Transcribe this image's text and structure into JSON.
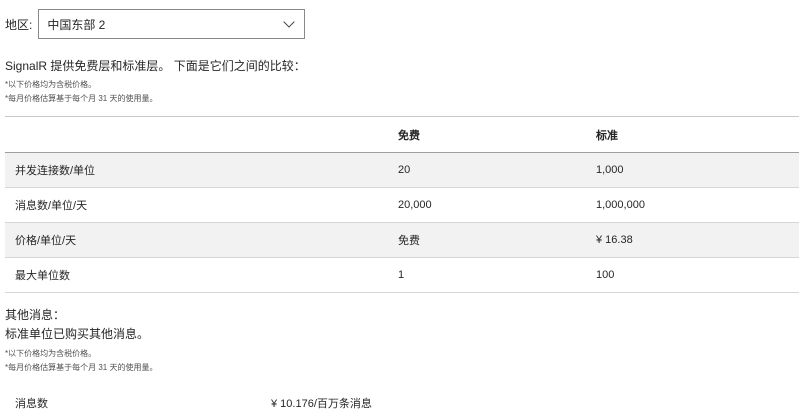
{
  "region": {
    "label": "地区:",
    "selected": "中国东部 2"
  },
  "intro_text": "SignalR 提供免费层和标准层。 下面是它们之间的比较：",
  "notes_top": [
    "*以下价格均为含税价格。",
    "*每月价格估算基于每个月 31 天的使用量。"
  ],
  "table": {
    "headers": [
      "",
      "免费",
      "标准"
    ],
    "rows": [
      [
        "并发连接数/单位",
        "20",
        "1,000"
      ],
      [
        "消息数/单位/天",
        "20,000",
        "1,000,000"
      ],
      [
        "价格/单位/天",
        "免费",
        "¥ 16.38"
      ],
      [
        "最大单位数",
        "1",
        "100"
      ]
    ]
  },
  "other": {
    "title": "其他消息：",
    "desc": "标准单位已购买其他消息。",
    "notes": [
      "*以下价格均为含税价格。",
      "*每月价格估算基于每个月 31 天的使用量。"
    ],
    "message_label": "消息数",
    "message_price": "¥ 10.176/百万条消息"
  }
}
